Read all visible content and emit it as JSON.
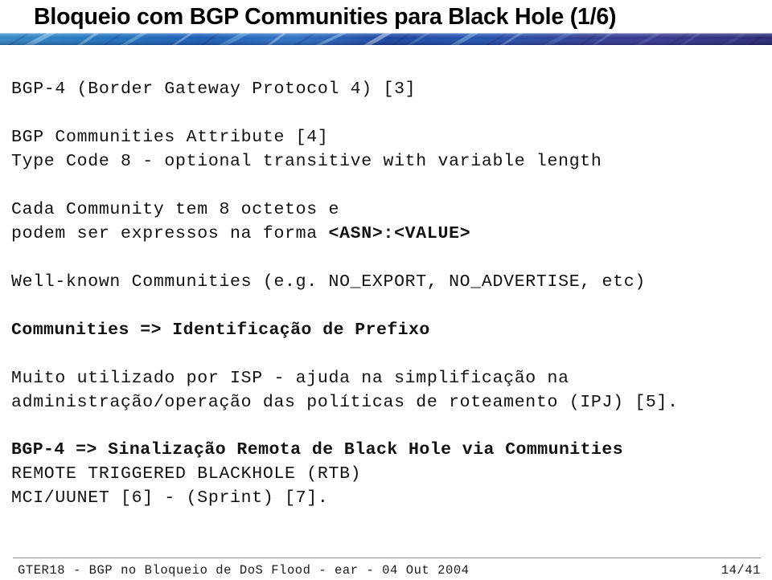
{
  "slide": {
    "title": "Bloqueio com BGP Communities para Black Hole (1/6)",
    "decor_rule": {
      "name": "marbled-blue-divider",
      "colors": [
        "#2a7fc1",
        "#1a5fae",
        "#0f3f9c",
        "#2f2f8f",
        "#3a3a99",
        "#7fb8e0",
        "#1c2f7a"
      ]
    },
    "body": {
      "blocks": [
        {
          "id": "block-bgp4",
          "lines": [
            {
              "text": "BGP-4 (Border Gateway Protocol 4) [3]",
              "bold": false
            }
          ]
        },
        {
          "id": "block-communities-attribute",
          "lines": [
            {
              "text": "BGP Communities Attribute [4]",
              "bold": false
            },
            {
              "text": "Type Code 8 - optional transitive with variable length",
              "bold": false
            }
          ]
        },
        {
          "id": "block-octetos",
          "lines": [
            {
              "text": "Cada Community tem 8 octetos e",
              "bold": false
            },
            {
              "text_prefix": "podem ser expressos na forma ",
              "text_bold": "<ASN>:<VALUE>",
              "bold": false,
              "mixed": true
            }
          ]
        },
        {
          "id": "block-well-known",
          "lines": [
            {
              "text": "Well-known Communities (e.g. NO_EXPORT, NO_ADVERTISE, etc)",
              "bold": false
            }
          ]
        },
        {
          "id": "block-identificacao",
          "lines": [
            {
              "text": "Communities => Identificação de Prefixo",
              "bold": true
            }
          ]
        },
        {
          "id": "block-isp",
          "lines": [
            {
              "text": "Muito utilizado por ISP - ajuda na simplificação na",
              "bold": false
            },
            {
              "text": "administração/operação das políticas de roteamento (IPJ) [5].",
              "bold": false
            }
          ]
        },
        {
          "id": "block-sinalizacao",
          "lines": [
            {
              "text": "BGP-4 => Sinalização Remota de Black Hole via Communities",
              "bold": true
            },
            {
              "text": "REMOTE TRIGGERED BLACKHOLE (RTB)",
              "bold": false
            },
            {
              "text": "MCI/UUNET [6] - (Sprint) [7].",
              "bold": false
            }
          ]
        }
      ]
    },
    "footer": {
      "left": "GTER18 - BGP no Bloqueio de DoS Flood - ear - 04 Out 2004",
      "page": "14/41"
    }
  }
}
